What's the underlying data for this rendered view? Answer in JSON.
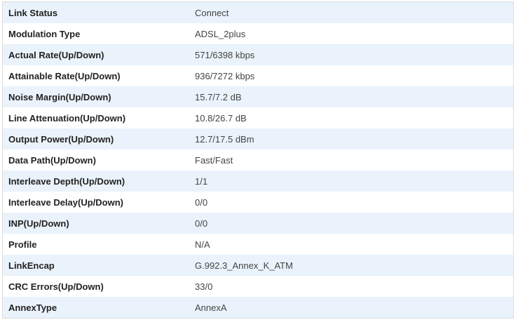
{
  "status_table": {
    "rows": [
      {
        "label": "Link Status",
        "value": "Connect"
      },
      {
        "label": "Modulation Type",
        "value": "ADSL_2plus"
      },
      {
        "label": "Actual Rate(Up/Down)",
        "value": "571/6398 kbps"
      },
      {
        "label": "Attainable Rate(Up/Down)",
        "value": "936/7272 kbps"
      },
      {
        "label": "Noise Margin(Up/Down)",
        "value": "15.7/7.2 dB"
      },
      {
        "label": "Line Attenuation(Up/Down)",
        "value": "10.8/26.7 dB"
      },
      {
        "label": "Output Power(Up/Down)",
        "value": "12.7/17.5 dBm"
      },
      {
        "label": "Data Path(Up/Down)",
        "value": "Fast/Fast"
      },
      {
        "label": "Interleave Depth(Up/Down)",
        "value": "1/1"
      },
      {
        "label": "Interleave Delay(Up/Down)",
        "value": "0/0"
      },
      {
        "label": "INP(Up/Down)",
        "value": "0/0"
      },
      {
        "label": "Profile",
        "value": "N/A"
      },
      {
        "label": "LinkEncap",
        "value": "G.992.3_Annex_K_ATM"
      },
      {
        "label": "CRC Errors(Up/Down)",
        "value": "33/0"
      },
      {
        "label": "AnnexType",
        "value": "AnnexA"
      }
    ]
  },
  "colors": {
    "stripe": "#eaf3fb",
    "border": "#dcdcdc",
    "label_text": "#222222",
    "value_text": "#444444"
  }
}
